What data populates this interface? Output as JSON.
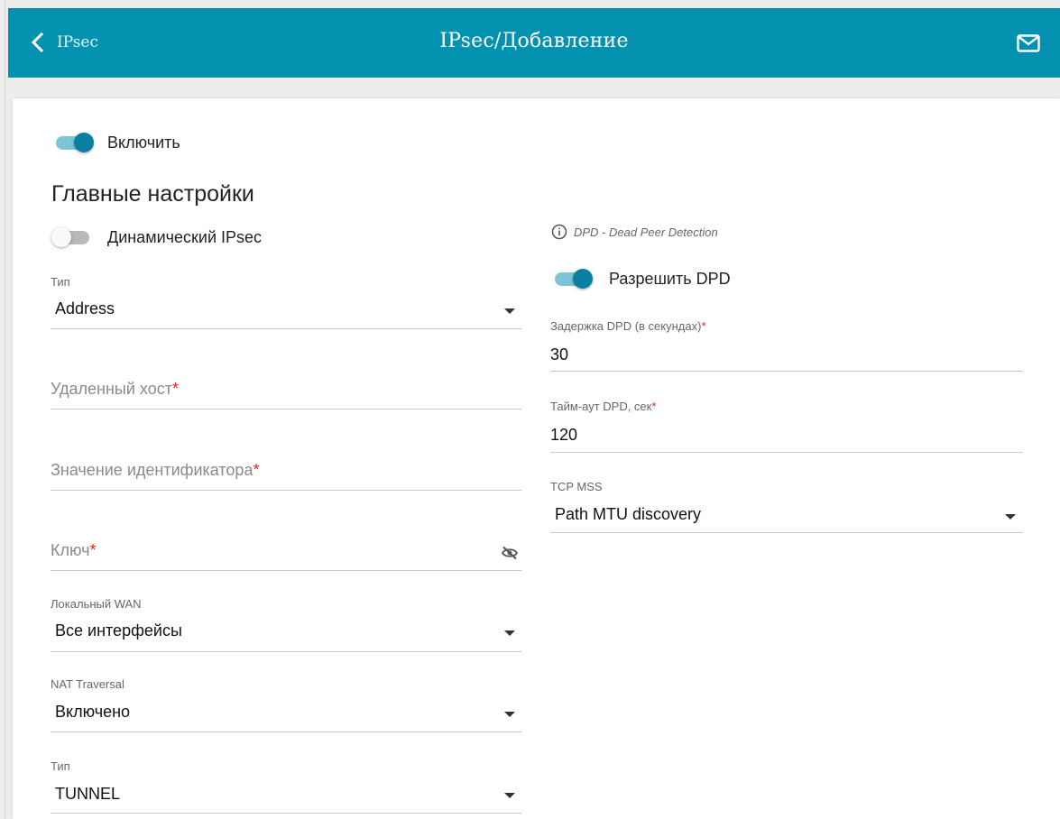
{
  "header": {
    "back_label": "IPsec",
    "title": "IPsec/Добавление",
    "back_icon": "chevron-left-icon",
    "mail_icon": "mail-icon"
  },
  "enable": {
    "label": "Включить",
    "on": true
  },
  "main_section": {
    "title": "Главные настройки"
  },
  "dynamic_ipsec": {
    "label": "Динамический IPsec",
    "on": false
  },
  "type1": {
    "label": "Тип",
    "value": "Address"
  },
  "remote_host": {
    "placeholder": "Удаленный хост",
    "required_mark": "*"
  },
  "identifier_value": {
    "placeholder": "Значение идентификатора",
    "required_mark": "*"
  },
  "key": {
    "placeholder": "Ключ",
    "required_mark": "*",
    "icon": "eye-off-icon"
  },
  "local_wan": {
    "label": "Локальный WAN",
    "value": "Все интерфейсы"
  },
  "nat_traversal": {
    "label": "NAT Traversal",
    "value": "Включено"
  },
  "type2": {
    "label": "Тип",
    "value": "TUNNEL"
  },
  "dpd_info": {
    "text": "DPD - Dead Peer Detection",
    "icon": "info-icon"
  },
  "allow_dpd": {
    "label": "Разрешить DPD",
    "on": true
  },
  "dpd_delay": {
    "label": "Задержка DPD (в секундах)",
    "required_mark": "*",
    "value": "30"
  },
  "dpd_timeout": {
    "label": "Тайм-аут DPD, сек",
    "required_mark": "*",
    "value": "120"
  },
  "tcp_mss": {
    "label": "TCP MSS",
    "value": "Path MTU discovery"
  },
  "colors": {
    "header_bg": "#0391b0",
    "toggle_on": "#0a7fa0",
    "required": "#e52222"
  }
}
